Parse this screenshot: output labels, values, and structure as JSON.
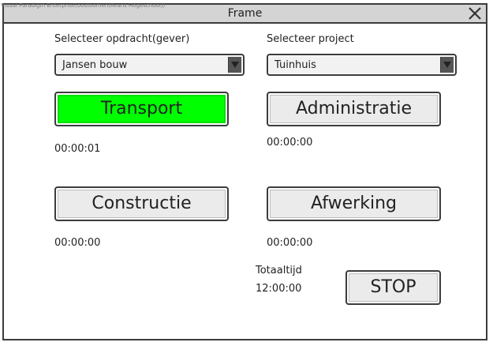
{
  "window": {
    "watermark": "Visual Paradigm Enterprise(oostoomen(Avans Hogeschool))",
    "title": "Frame"
  },
  "form": {
    "client_label": "Selecteer opdracht(gever)",
    "client_value": "Jansen bouw",
    "project_label": "Selecteer project",
    "project_value": "Tuinhuis"
  },
  "tasks": [
    {
      "label": "Transport",
      "time": "00:00:01",
      "active": true
    },
    {
      "label": "Administratie",
      "time": "00:00:00",
      "active": false
    },
    {
      "label": "Constructie",
      "time": "00:00:00",
      "active": false
    },
    {
      "label": "Afwerking",
      "time": "00:00:00",
      "active": false
    }
  ],
  "total": {
    "label": "Totaaltijd",
    "value": "12:00:00"
  },
  "stop_label": "STOP",
  "colors": {
    "active_button": "#00ff00",
    "titlebar": "#d4d4d4",
    "border": "#3c3c3c"
  },
  "icons": {
    "close": "close-icon",
    "dropdown": "chevron-down-icon"
  }
}
